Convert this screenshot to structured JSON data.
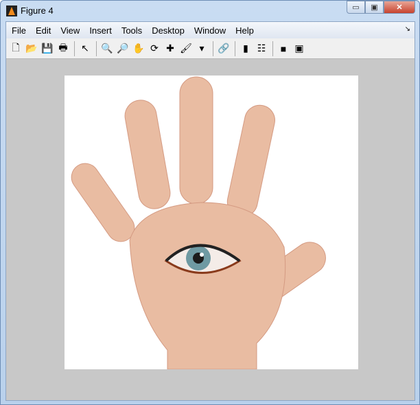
{
  "window": {
    "title": "Figure 4",
    "min": "▭",
    "max": "▣",
    "close": "✕"
  },
  "menu": [
    "File",
    "Edit",
    "View",
    "Insert",
    "Tools",
    "Desktop",
    "Window",
    "Help"
  ],
  "menu_overflow": "↘",
  "toolbar": [
    {
      "name": "new-figure-icon",
      "glyph": "🗋"
    },
    {
      "name": "open-file-icon",
      "glyph": "📂"
    },
    {
      "name": "save-icon",
      "glyph": "💾"
    },
    {
      "name": "print-icon",
      "glyph": "🖶"
    },
    {
      "sep": true
    },
    {
      "name": "edit-plot-icon",
      "glyph": "↖"
    },
    {
      "sep": true
    },
    {
      "name": "zoom-in-icon",
      "glyph": "🔍"
    },
    {
      "name": "zoom-out-icon",
      "glyph": "🔎"
    },
    {
      "name": "pan-icon",
      "glyph": "✋"
    },
    {
      "name": "rotate-3d-icon",
      "glyph": "⟳"
    },
    {
      "name": "data-cursor-icon",
      "glyph": "✚"
    },
    {
      "name": "brush-icon",
      "glyph": "🖌"
    },
    {
      "name": "brush-dropdown-icon",
      "glyph": "▾"
    },
    {
      "sep": true
    },
    {
      "name": "link-plot-icon",
      "glyph": "🔗"
    },
    {
      "sep": true
    },
    {
      "name": "colorbar-icon",
      "glyph": "▮"
    },
    {
      "name": "legend-icon",
      "glyph": "☷"
    },
    {
      "sep": true
    },
    {
      "name": "hide-plot-tools-icon",
      "glyph": "■"
    },
    {
      "name": "show-plot-tools-icon",
      "glyph": "▣"
    }
  ],
  "colors": {
    "skin": "#e9bca2",
    "iris": "#6f9aa3",
    "figure_bg": "#c8c8c8"
  }
}
